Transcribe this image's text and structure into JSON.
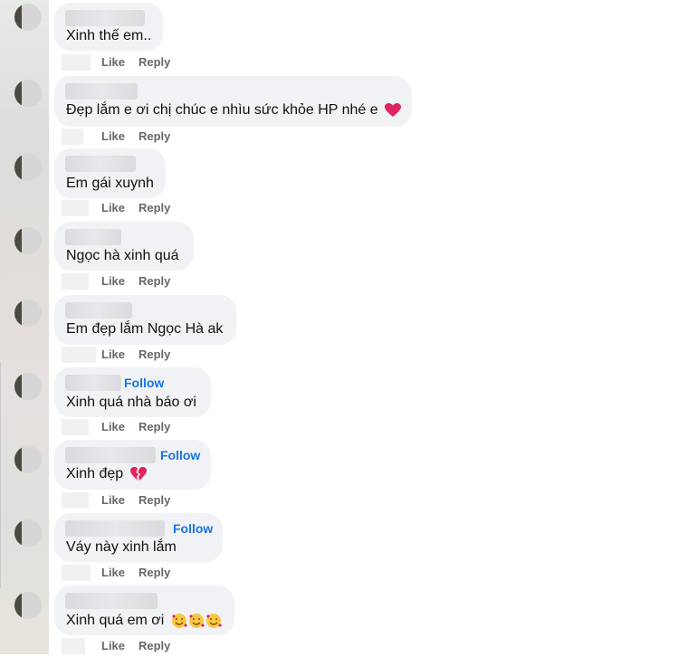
{
  "actions": {
    "like_label": "Like",
    "reply_label": "Reply",
    "follow_label": "Follow"
  },
  "comments": [
    {
      "text": "Xinh thế em..",
      "emoji": ""
    },
    {
      "text": "Đẹp lắm e ơi chị chúc e nhìu sức khỏe HP nhé e",
      "emoji": "heart"
    },
    {
      "text": "Em gái xuynh",
      "emoji": ""
    },
    {
      "text": "Ngọc hà xinh quá",
      "emoji": ""
    },
    {
      "text": "Em đẹp lắm Ngọc Hà ak",
      "emoji": ""
    },
    {
      "text": "Xinh quá nhà báo ơi",
      "emoji": "",
      "follow": true
    },
    {
      "text": "Xinh đẹp",
      "emoji": "broken-heart",
      "follow": true
    },
    {
      "text": "Váy này xinh lắm",
      "emoji": "",
      "follow": true
    },
    {
      "text": "Xinh quá em ơi",
      "emoji": "smiling-face-with-hearts-x3"
    }
  ],
  "colors": {
    "bubble": "#f0f2f5",
    "follow": "#1a73e8",
    "action": "#65676b",
    "heart": "#e0245e"
  }
}
